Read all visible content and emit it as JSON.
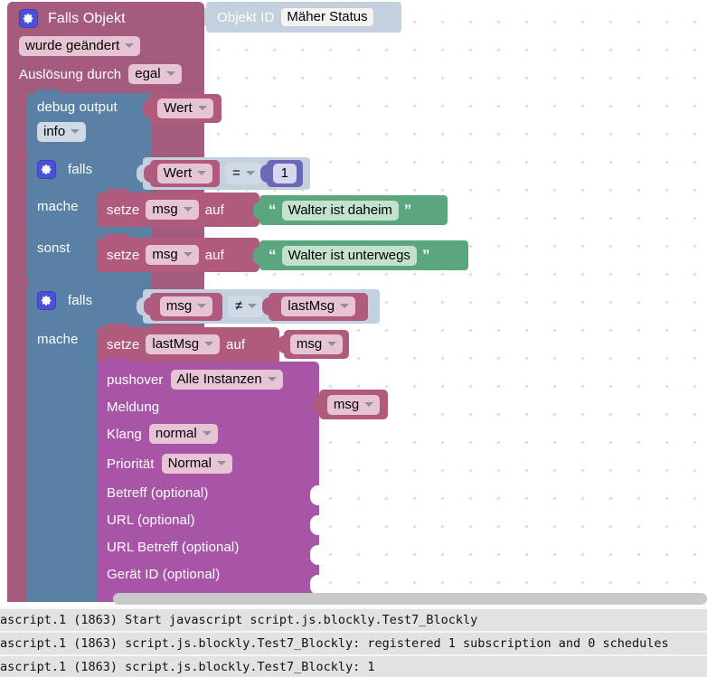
{
  "workspace": {
    "trigger_block": {
      "title": "Falls Objekt",
      "gear_icon": "gear-icon",
      "condition_field": "wurde geändert",
      "trigger_by_label": "Auslösung durch",
      "trigger_by_field": "egal",
      "object_id_label": "Objekt ID",
      "object_id_value": "Mäher Status"
    },
    "debug_block": {
      "label": "debug output",
      "value_field": "Wert",
      "level_field": "info"
    },
    "if_block_1": {
      "gear_icon": "gear-icon",
      "if_label": "falls",
      "do_label": "mache",
      "else_label": "sonst",
      "condition": {
        "left": "Wert",
        "operator": "=",
        "right": "1"
      },
      "do_statement": {
        "set_label": "setze",
        "variable": "msg",
        "to_label": "auf",
        "string_value": "Walter ist daheim",
        "quote_open": "“",
        "quote_close": "”"
      },
      "else_statement": {
        "set_label": "setze",
        "variable": "msg",
        "to_label": "auf",
        "string_value": "Walter ist unterwegs",
        "quote_open": "“",
        "quote_close": "”"
      }
    },
    "if_block_2": {
      "gear_icon": "gear-icon",
      "if_label": "falls",
      "do_label": "mache",
      "condition": {
        "left": "msg",
        "operator": "≠",
        "right": "lastMsg"
      },
      "set_statement": {
        "set_label": "setze",
        "variable": "lastMsg",
        "to_label": "auf",
        "value": "msg"
      },
      "pushover_block": {
        "title": "pushover",
        "instance_field": "Alle Instanzen",
        "rows": [
          {
            "label": "Meldung",
            "value": "msg",
            "kind": "value"
          },
          {
            "label": "Klang",
            "value": "normal",
            "kind": "dropdown"
          },
          {
            "label": "Priorität",
            "value": "Normal",
            "kind": "dropdown"
          },
          {
            "label": "Betreff (optional)",
            "value": "",
            "kind": "socket"
          },
          {
            "label": "URL (optional)",
            "value": "",
            "kind": "socket"
          },
          {
            "label": "URL Betreff (optional)",
            "value": "",
            "kind": "socket"
          },
          {
            "label": "Gerät ID (optional)",
            "value": "",
            "kind": "socket"
          }
        ]
      }
    },
    "colors": {
      "trigger": "#a45b7e",
      "debug": "#5b80a5",
      "control": "#5b80a5",
      "variable": "#b05a7e",
      "text": "#5ba57f",
      "math": "#6b68b8",
      "sendto": "#a855a8",
      "logic": "#c3d0dd"
    }
  },
  "console": {
    "lines": [
      "ascript.1 (1863) Start javascript script.js.blockly.Test7_Blockly",
      "ascript.1 (1863) script.js.blockly.Test7_Blockly: registered 1 subscription and 0 schedules",
      "ascript.1 (1863) script.js.blockly.Test7_Blockly: 1"
    ]
  }
}
